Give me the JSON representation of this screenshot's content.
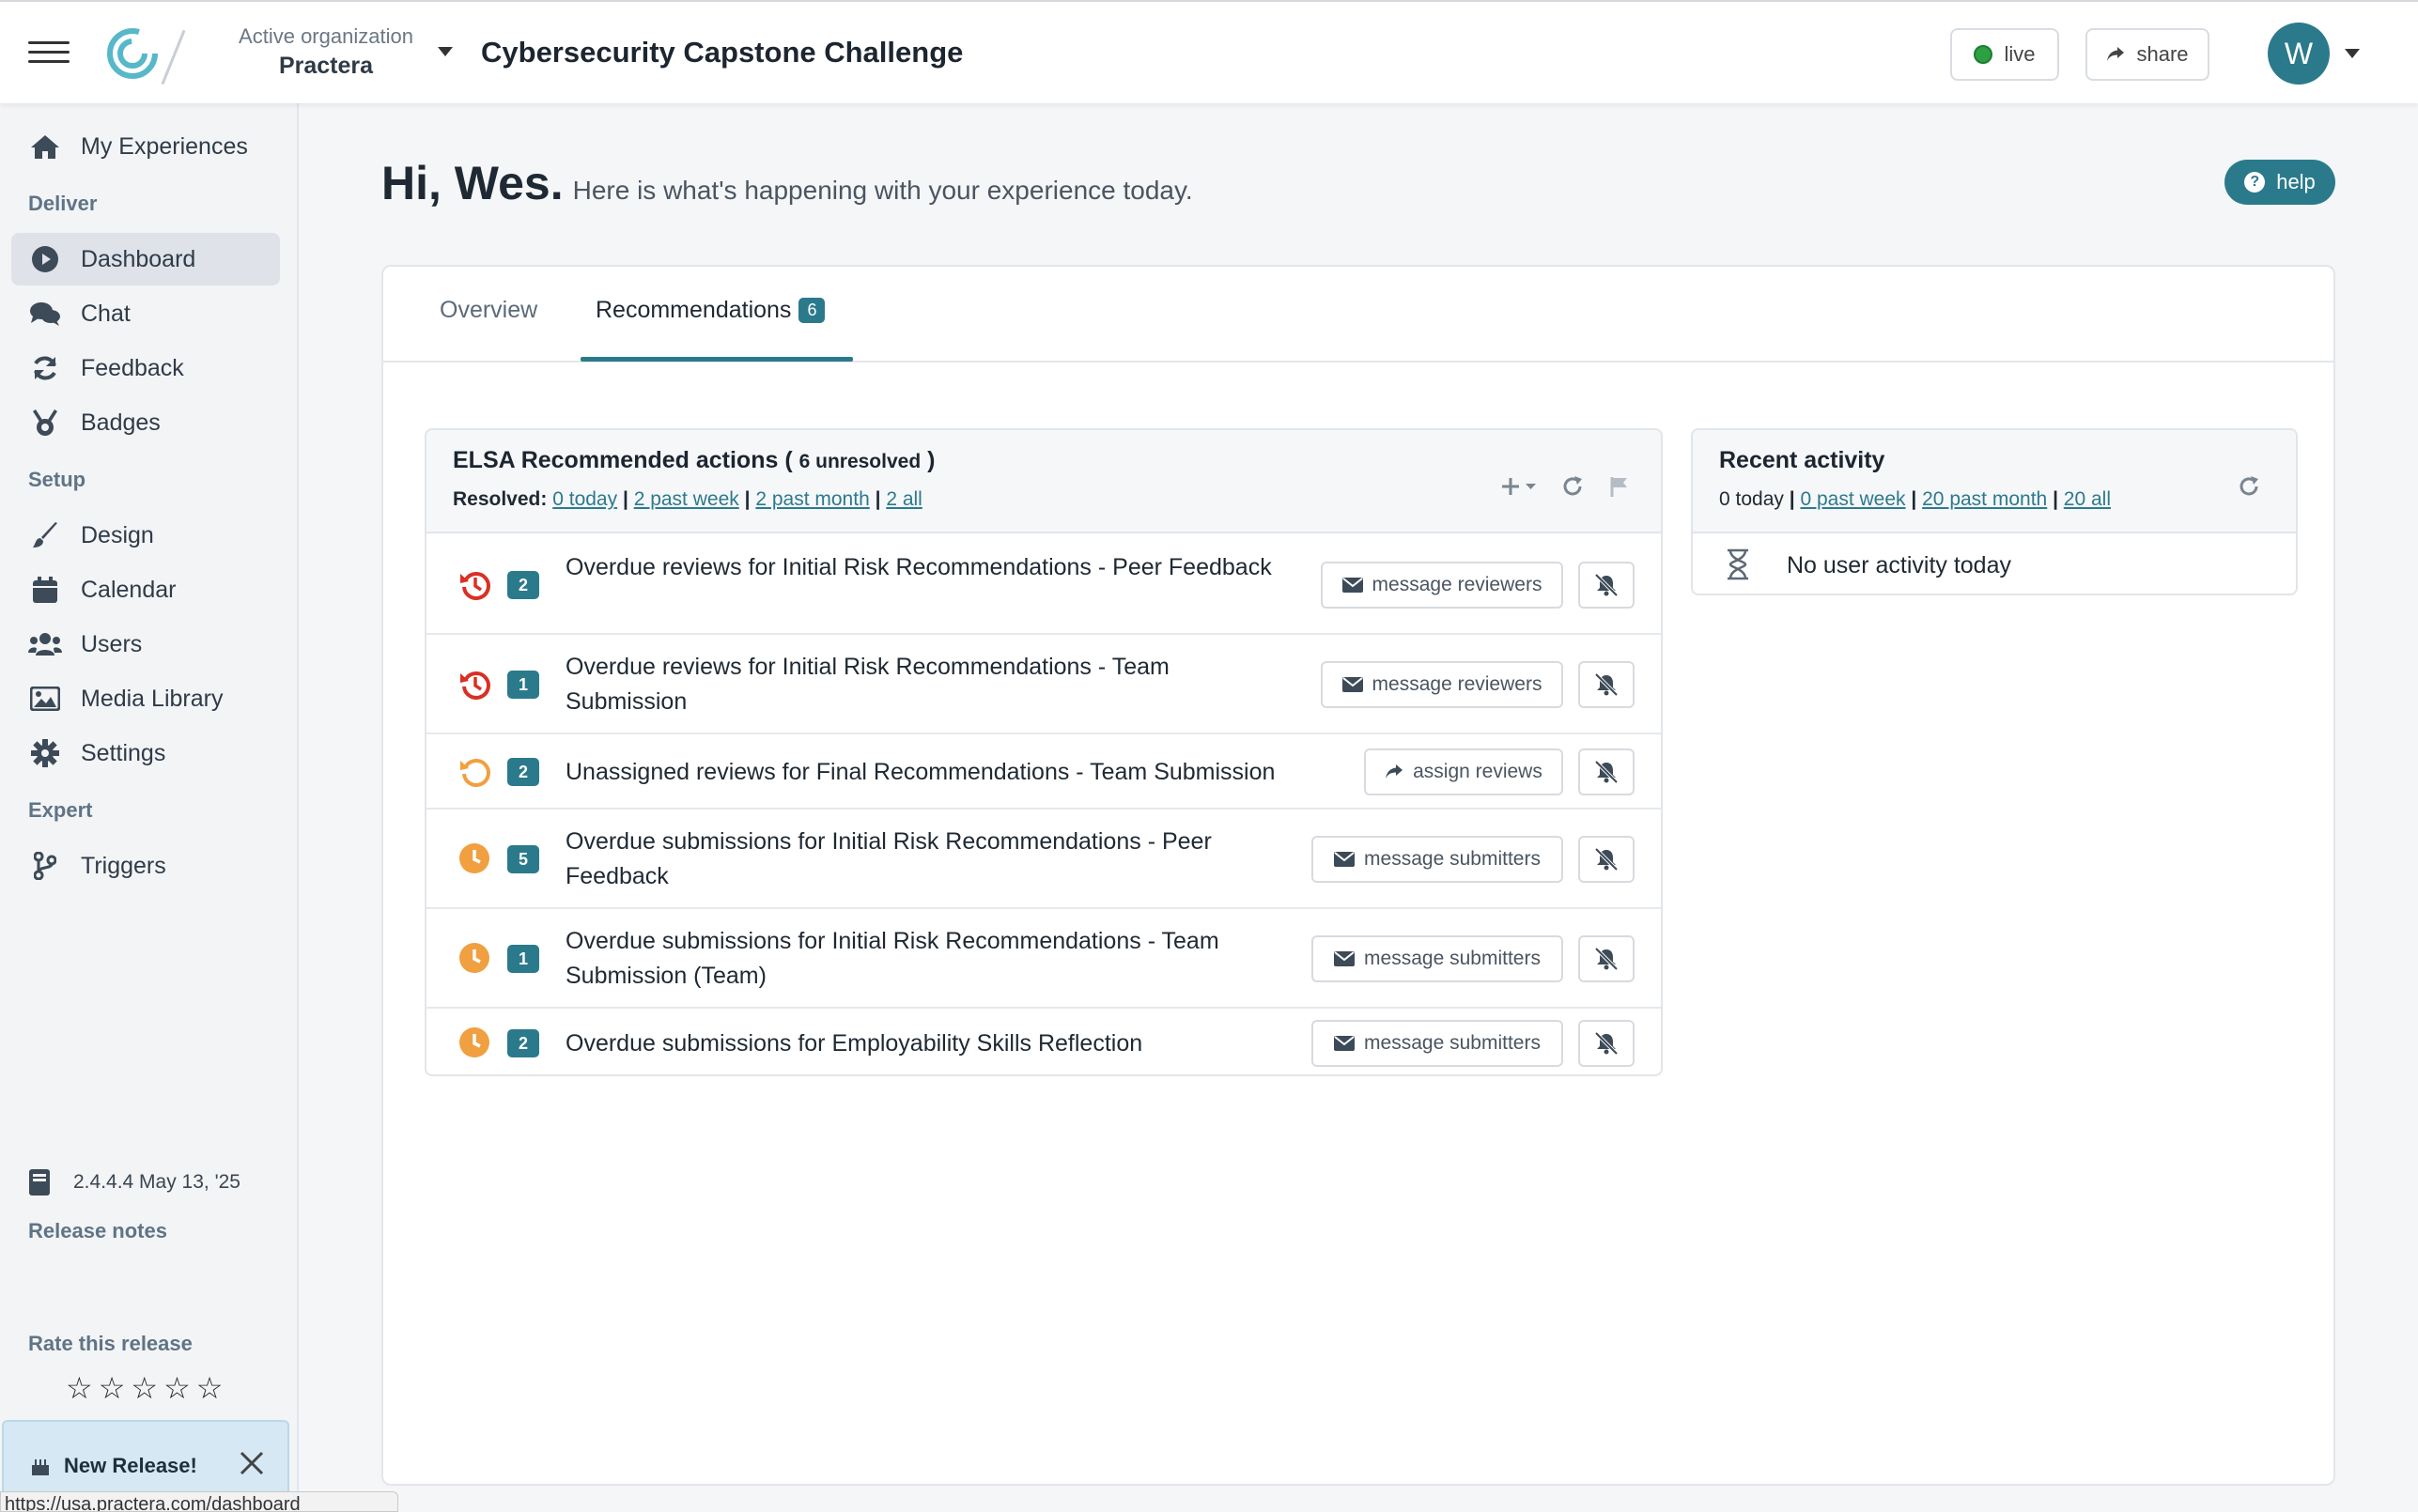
{
  "header": {
    "org_label": "Active organization",
    "org_name": "Practera",
    "experience_title": "Cybersecurity Capstone Challenge",
    "live_label": "live",
    "share_label": "share",
    "avatar_initial": "W",
    "live_color": "#2ea043",
    "accent_color": "#2b7a8c"
  },
  "sidebar": {
    "my_experiences": "My Experiences",
    "section_deliver": "Deliver",
    "dashboard": "Dashboard",
    "chat": "Chat",
    "feedback": "Feedback",
    "badges": "Badges",
    "section_setup": "Setup",
    "design": "Design",
    "calendar": "Calendar",
    "users": "Users",
    "media_library": "Media Library",
    "settings": "Settings",
    "section_expert": "Expert",
    "triggers": "Triggers",
    "release_notes_label": "Release notes",
    "release_version": "2.4.4.4 May 13, '25",
    "rate_label": "Rate this release",
    "rating_max": 5,
    "rating_value": 0,
    "new_release_label": "New Release!"
  },
  "status_url": "https://usa.practera.com/dashboard",
  "main": {
    "greeting": "Hi, Wes.",
    "greeting_sub": "Here is what's happening with your experience today.",
    "help_label": "help",
    "tabs": {
      "overview": "Overview",
      "recommendations": "Recommendations",
      "recommendations_count": "6"
    }
  },
  "recommended": {
    "title": "ELSA Recommended actions (",
    "unresolved": "6 unresolved",
    "title_close": ")",
    "resolved_label": "Resolved:",
    "resolved_today": "0 today",
    "resolved_week": "2 past week",
    "resolved_month": "2 past month",
    "resolved_all": "2 all",
    "separator": "|",
    "rows": [
      {
        "count": "2",
        "icon": "history-red-icon",
        "text": "Overdue reviews for Initial Risk Recommendations - Peer Feedback",
        "action": "message reviewers",
        "action_icon": "envelope-icon"
      },
      {
        "count": "1",
        "icon": "history-red-icon",
        "text": "Overdue reviews for Initial Risk Recommendations - Team Submission",
        "action": "message reviewers",
        "action_icon": "envelope-icon"
      },
      {
        "count": "2",
        "icon": "undo-orange-icon",
        "text": "Unassigned reviews for Final Recommendations - Team Submission",
        "action": "assign reviews",
        "action_icon": "share-icon"
      },
      {
        "count": "5",
        "icon": "clock-orange-icon",
        "text": "Overdue submissions for Initial Risk Recommendations - Peer Feedback",
        "action": "message submitters",
        "action_icon": "envelope-icon"
      },
      {
        "count": "1",
        "icon": "clock-orange-icon",
        "text": "Overdue submissions for Initial Risk Recommendations - Team Submission (Team)",
        "action": "message submitters",
        "action_icon": "envelope-icon"
      },
      {
        "count": "2",
        "icon": "clock-orange-icon",
        "text": "Overdue submissions for Employability Skills Reflection",
        "action": "message submitters",
        "action_icon": "envelope-icon"
      }
    ],
    "colors": {
      "red": "#d93025",
      "orange": "#f0a040"
    }
  },
  "activity": {
    "title": "Recent activity",
    "today": "0 today",
    "past_week": "0 past week",
    "past_month": "20 past month",
    "all": "20 all",
    "separator": "|",
    "empty_text": "No user activity today"
  }
}
